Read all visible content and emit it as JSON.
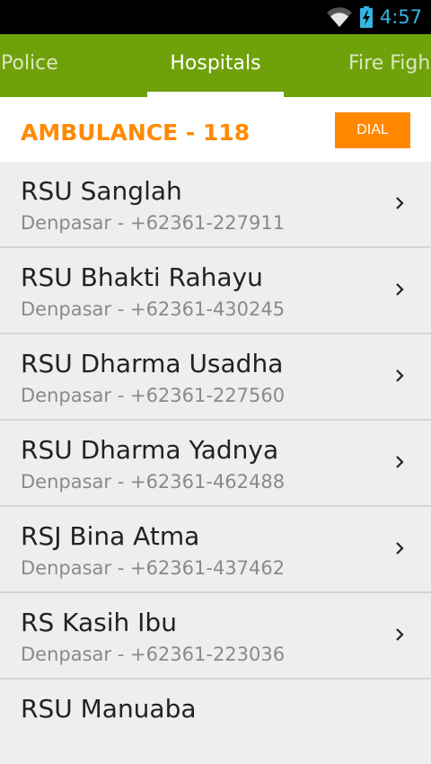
{
  "status_bar": {
    "time": "4:57",
    "icons": [
      "wifi-icon",
      "battery-charging-icon"
    ],
    "accent": "#33b5e5"
  },
  "tabs": [
    {
      "label": "Police"
    },
    {
      "label": "Hospitals",
      "selected": true
    },
    {
      "label": "Fire Figh"
    }
  ],
  "tab_color": "#6fa10a",
  "emergency": {
    "label": "AMBULANCE - 118",
    "button": "DIAL",
    "accent": "#ff8800"
  },
  "hospitals": [
    {
      "name": "RSU Sanglah",
      "detail": "Denpasar - +62361-227911"
    },
    {
      "name": "RSU Bhakti Rahayu",
      "detail": "Denpasar - +62361-430245"
    },
    {
      "name": "RSU Dharma Usadha",
      "detail": "Denpasar - +62361-227560"
    },
    {
      "name": "RSU Dharma Yadnya",
      "detail": "Denpasar - +62361-462488"
    },
    {
      "name": "RSJ Bina Atma",
      "detail": "Denpasar - +62361-437462"
    },
    {
      "name": "RS Kasih Ibu",
      "detail": "Denpasar - +62361-223036"
    },
    {
      "name": "RSU Manuaba",
      "detail": ""
    }
  ]
}
